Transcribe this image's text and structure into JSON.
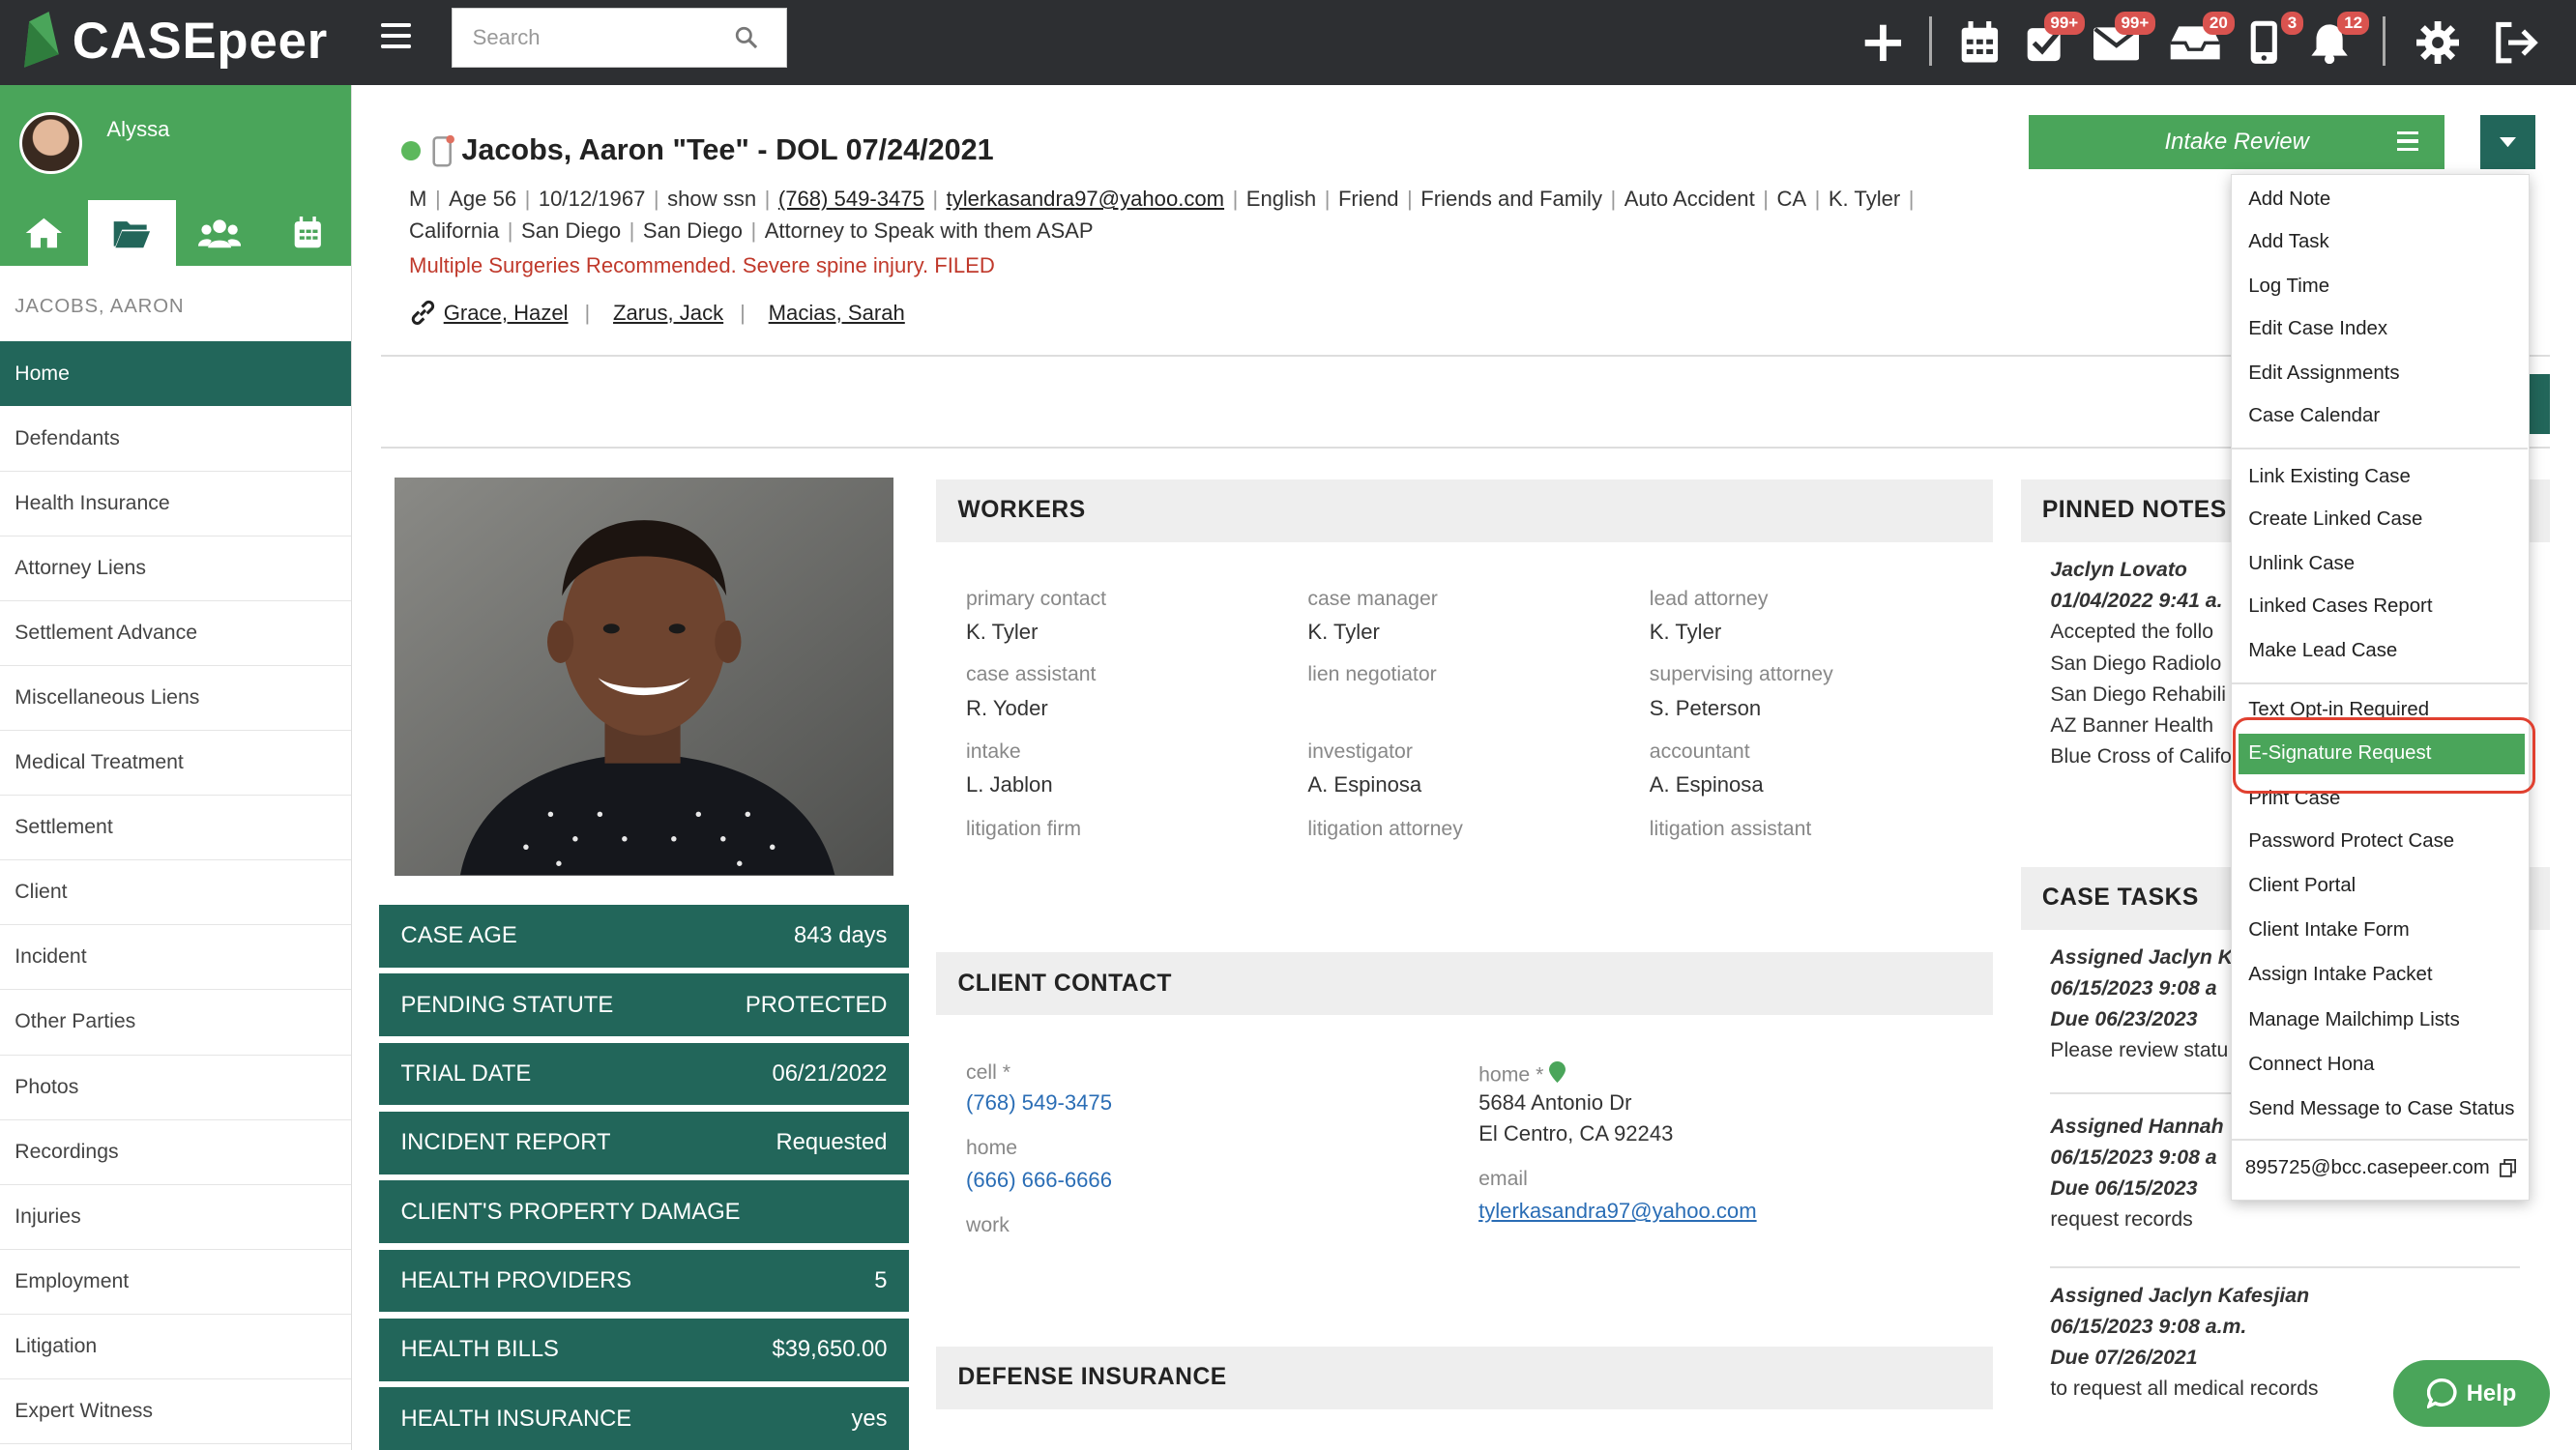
{
  "app": {
    "name": "CASEpeer"
  },
  "search": {
    "placeholder": "Search"
  },
  "toolbar": {
    "badges": {
      "tasks": "99+",
      "mail": "99+",
      "inbox": "20",
      "phone": "3",
      "alerts": "12"
    }
  },
  "user": {
    "name": "Alyssa"
  },
  "sidebar": {
    "case_header": "JACOBS, AARON",
    "items": [
      "Home",
      "Defendants",
      "Health Insurance",
      "Attorney Liens",
      "Settlement Advance",
      "Miscellaneous Liens",
      "Medical Treatment",
      "Settlement",
      "Client",
      "Incident",
      "Other Parties",
      "Photos",
      "Recordings",
      "Injuries",
      "Employment",
      "Litigation",
      "Expert Witness"
    ]
  },
  "case": {
    "title": "Jacobs, Aaron \"Tee\" - DOL 07/24/2021",
    "gender": "M",
    "age": "Age 56",
    "dob": "10/12/1967",
    "ssn": "show ssn",
    "phone": "(768) 549-3475",
    "email": "tylerkasandra97@yahoo.com",
    "language": "English",
    "referral": "Friend",
    "referral_type": "Friends and Family",
    "case_type": "Auto Accident",
    "state": "CA",
    "staff": "K. Tyler",
    "state_full": "California",
    "county": "San Diego",
    "city": "San Diego",
    "note": "Attorney to Speak with them ASAP",
    "alert": "Multiple Surgeries Recommended. Severe spine injury. FILED",
    "linked": [
      "Grace, Hazel",
      "Zarus, Jack",
      "Macias, Sarah"
    ]
  },
  "intake_status": "Intake Review",
  "stats": [
    {
      "label": "CASE AGE",
      "value": "843 days"
    },
    {
      "label": "PENDING STATUTE",
      "value": "PROTECTED"
    },
    {
      "label": "TRIAL DATE",
      "value": "06/21/2022"
    },
    {
      "label": "INCIDENT REPORT",
      "value": "Requested"
    },
    {
      "label": "CLIENT'S PROPERTY DAMAGE",
      "value": ""
    },
    {
      "label": "HEALTH PROVIDERS",
      "value": "5"
    },
    {
      "label": "HEALTH BILLS",
      "value": "$39,650.00"
    },
    {
      "label": "HEALTH INSURANCE",
      "value": "yes"
    }
  ],
  "workers": {
    "title": "WORKERS",
    "items": [
      {
        "role": "primary contact",
        "name": "K. Tyler"
      },
      {
        "role": "case manager",
        "name": "K. Tyler"
      },
      {
        "role": "lead attorney",
        "name": "K. Tyler"
      },
      {
        "role": "case assistant",
        "name": "R. Yoder"
      },
      {
        "role": "lien negotiator",
        "name": ""
      },
      {
        "role": "supervising attorney",
        "name": "S. Peterson"
      },
      {
        "role": "intake",
        "name": "L. Jablon"
      },
      {
        "role": "investigator",
        "name": "A. Espinosa"
      },
      {
        "role": "accountant",
        "name": "A. Espinosa"
      },
      {
        "role": "litigation firm",
        "name": ""
      },
      {
        "role": "litigation attorney",
        "name": ""
      },
      {
        "role": "litigation assistant",
        "name": ""
      }
    ]
  },
  "contact": {
    "title": "CLIENT CONTACT",
    "cell_label": "cell *",
    "cell": "(768) 549-3475",
    "home_label": "home",
    "home": "(666) 666-6666",
    "work_label": "work",
    "addr_label": "home *",
    "addr1": "5684 Antonio Dr",
    "addr2": "El Centro, CA 92243",
    "email_label": "email",
    "email": "tylerkasandra97@yahoo.com"
  },
  "defense": {
    "title": "DEFENSE INSURANCE"
  },
  "pinned": {
    "title": "PINNED NOTES",
    "lines": [
      "Jaclyn Lovato",
      "01/04/2022 9:41 a.",
      "Accepted the follo",
      "San Diego Radiolo",
      "San Diego Rehabili",
      "AZ Banner Health",
      "Blue Cross of Califo"
    ]
  },
  "tasks": {
    "title": "CASE TASKS",
    "t1": [
      "Assigned Jaclyn K",
      "06/15/2023 9:08 a",
      "Due 06/23/2023",
      "Please review statu"
    ],
    "t2": [
      "Assigned Hannah",
      "06/15/2023 9:08 a",
      "Due 06/15/2023",
      "request records"
    ],
    "t3": [
      "Assigned Jaclyn Kafesjian",
      "06/15/2023 9:08 a.m.",
      "Due 07/26/2021",
      "to request all medical records"
    ]
  },
  "menu": {
    "items": [
      "Add Note",
      "Add Task",
      "Log Time",
      "Edit Case Index",
      "Edit Assignments",
      "Case Calendar",
      "Link Existing Case",
      "Create Linked Case",
      "Unlink Case",
      "Linked Cases Report",
      "Make Lead Case",
      "Text Opt-in Required",
      "E-Signature Request",
      "Print Case",
      "Password Protect Case",
      "Client Portal",
      "Client Intake Form",
      "Assign Intake Packet",
      "Manage Mailchimp Lists",
      "Connect Hona",
      "Send Message to Case Status"
    ],
    "email": "895725@bcc.casepeer.com"
  },
  "help": {
    "label": "Help"
  }
}
